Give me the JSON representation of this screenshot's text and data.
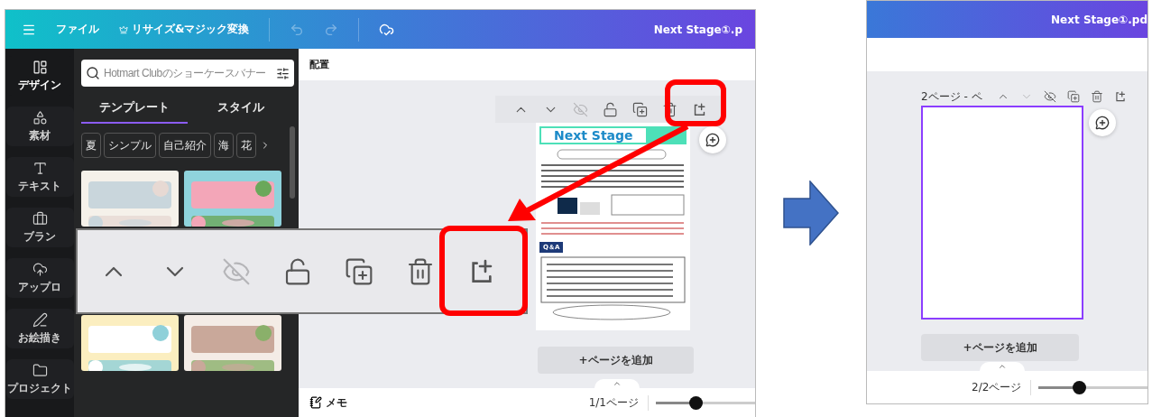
{
  "left_screen": {
    "top_bar": {
      "menu": [
        {
          "kind": "file",
          "label": "ファイル"
        },
        {
          "kind": "resize",
          "label": "リサイズ&マジック変換"
        }
      ],
      "undo_disabled": true,
      "redo_disabled": true,
      "document_title": "Next Stage①.p"
    },
    "sidebar": [
      {
        "kind": "design",
        "label": "デザイン",
        "selected": true
      },
      {
        "kind": "elements",
        "label": "素材",
        "selected": false
      },
      {
        "kind": "text",
        "label": "テキスト",
        "selected": false
      },
      {
        "kind": "brand",
        "label": "ブラン",
        "selected": false
      },
      {
        "kind": "upload",
        "label": "アップロ",
        "selected": false
      },
      {
        "kind": "draw",
        "label": "お絵描き",
        "selected": false
      },
      {
        "kind": "projects",
        "label": "プロジェクト",
        "selected": false
      }
    ],
    "search": {
      "placeholder": "Hotmart Clubのショーケースバナー"
    },
    "tabs": [
      {
        "label": "テンプレート",
        "selected": true
      },
      {
        "label": "スタイル",
        "selected": false
      }
    ],
    "chips": [
      "夏",
      "シンプル",
      "自己紹介",
      "海",
      "花"
    ],
    "templates": [
      {
        "kind": "picture"
      },
      {
        "kind": "picture"
      },
      {
        "kind": "picture"
      },
      {
        "kind": "picture"
      }
    ],
    "canvas_header": "配置",
    "page_toolbar": [
      {
        "kind": "up",
        "disabled": false
      },
      {
        "kind": "down",
        "disabled": false
      },
      {
        "kind": "hide",
        "disabled": true
      },
      {
        "kind": "lock",
        "disabled": false
      },
      {
        "kind": "duplicate",
        "disabled": false
      },
      {
        "kind": "delete",
        "disabled": false
      },
      {
        "kind": "add",
        "disabled": false
      }
    ],
    "page": {
      "heading": "Next Stage",
      "section": "Q＆A"
    },
    "add_page": "+ページを追加",
    "footer": {
      "notes": "メモ",
      "page_count": "1/1ページ",
      "zoom": {
        "level": 0.4
      }
    }
  },
  "callout_toolbar": [
    {
      "kind": "up",
      "disabled": false
    },
    {
      "kind": "down",
      "disabled": false
    },
    {
      "kind": "hide",
      "disabled": true
    },
    {
      "kind": "lock",
      "disabled": false
    },
    {
      "kind": "duplicate",
      "disabled": false
    },
    {
      "kind": "delete",
      "disabled": false
    },
    {
      "kind": "add",
      "disabled": false
    }
  ],
  "right_screen": {
    "document_title": "Next Stage①.pd",
    "page_label": "2ページ - ペ",
    "page_toolbar": [
      {
        "kind": "up",
        "disabled": false
      },
      {
        "kind": "down",
        "disabled": true
      },
      {
        "kind": "hide",
        "disabled": false
      },
      {
        "kind": "duplicate",
        "disabled": false
      },
      {
        "kind": "delete",
        "disabled": false
      },
      {
        "kind": "add",
        "disabled": false
      }
    ],
    "page_selected": true,
    "add_page": "+ページを追加",
    "footer": {
      "page_count": "2/2ページ",
      "zoom": {
        "level": 0.37
      }
    }
  }
}
